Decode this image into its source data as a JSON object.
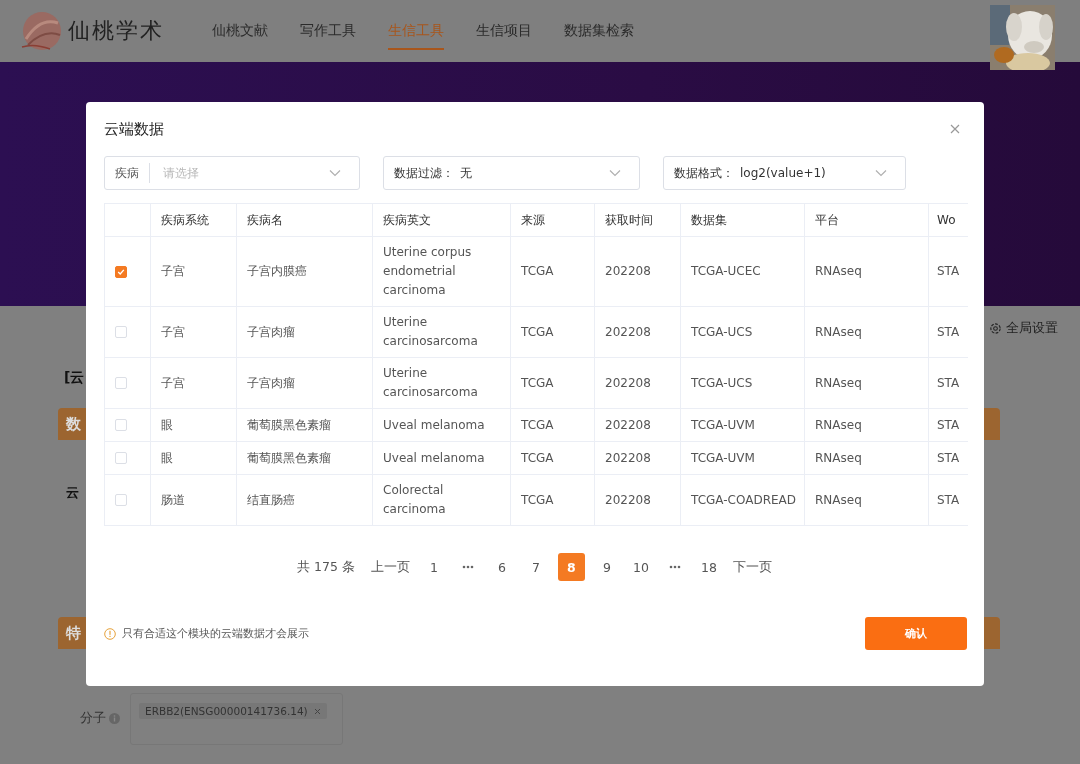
{
  "header": {
    "logo_text": "仙桃学术",
    "nav": [
      {
        "label": "仙桃文献",
        "selected": false
      },
      {
        "label": "写作工具",
        "selected": false
      },
      {
        "label": "生信工具",
        "selected": true
      },
      {
        "label": "生信项目",
        "selected": false
      },
      {
        "label": "数据集检索",
        "selected": false
      }
    ]
  },
  "page": {
    "settings_link": "全局设置",
    "section_title": "[云",
    "panels": [
      {
        "label": "数"
      },
      {
        "label": "特"
      }
    ],
    "row_label": "云",
    "molecule_label": "分子",
    "molecule_tags": [
      "ERBB2(ENSG00000141736.14)"
    ]
  },
  "dialog": {
    "title": "云端数据",
    "filters": [
      {
        "kind": "addon",
        "label": "疾病",
        "placeholder": "请选择"
      },
      {
        "kind": "inline",
        "label": "数据过滤：",
        "value": "无"
      },
      {
        "kind": "inline",
        "label": "数据格式：",
        "value": "log2(value+1)"
      }
    ],
    "table": {
      "columns": [
        "疾病系统",
        "疾病名",
        "疾病英文",
        "来源",
        "获取时间",
        "数据集",
        "平台",
        "Wo"
      ],
      "rows": [
        {
          "checked": true,
          "cells": [
            "子宫",
            "子宫内膜癌",
            "Uterine corpus endometrial carcinoma",
            "TCGA",
            "202208",
            "TCGA-UCEC",
            "RNAseq",
            "STA"
          ]
        },
        {
          "checked": false,
          "cells": [
            "子宫",
            "子宫肉瘤",
            "Uterine carcinosarcoma",
            "TCGA",
            "202208",
            "TCGA-UCS",
            "RNAseq",
            "STA"
          ]
        },
        {
          "checked": false,
          "cells": [
            "子宫",
            "子宫肉瘤",
            "Uterine carcinosarcoma",
            "TCGA",
            "202208",
            "TCGA-UCS",
            "RNAseq",
            "STA"
          ]
        },
        {
          "checked": false,
          "cells": [
            "眼",
            "葡萄膜黑色素瘤",
            "Uveal melanoma",
            "TCGA",
            "202208",
            "TCGA-UVM",
            "RNAseq",
            "STA"
          ]
        },
        {
          "checked": false,
          "cells": [
            "眼",
            "葡萄膜黑色素瘤",
            "Uveal melanoma",
            "TCGA",
            "202208",
            "TCGA-UVM",
            "RNAseq",
            "STA"
          ]
        },
        {
          "checked": false,
          "cells": [
            "肠道",
            "结直肠癌",
            "Colorectal carcinoma",
            "TCGA",
            "202208",
            "TCGA-COADREAD",
            "RNAseq",
            "STA"
          ]
        }
      ]
    },
    "pagination": {
      "total": "共 175 条",
      "items": [
        {
          "kind": "prev",
          "label": "上一页",
          "selected": false
        },
        {
          "kind": "page",
          "label": "1",
          "selected": false
        },
        {
          "kind": "ellipsis",
          "selected": false
        },
        {
          "kind": "page",
          "label": "6",
          "selected": false
        },
        {
          "kind": "page",
          "label": "7",
          "selected": false
        },
        {
          "kind": "page",
          "label": "8",
          "selected": true
        },
        {
          "kind": "page",
          "label": "9",
          "selected": false
        },
        {
          "kind": "page",
          "label": "10",
          "selected": false
        },
        {
          "kind": "ellipsis",
          "selected": false
        },
        {
          "kind": "page",
          "label": "18",
          "selected": false
        },
        {
          "kind": "next",
          "label": "下一页",
          "selected": false
        }
      ]
    },
    "notice": "只有合适这个模块的云端数据才会展示",
    "confirm_button": "确认"
  }
}
